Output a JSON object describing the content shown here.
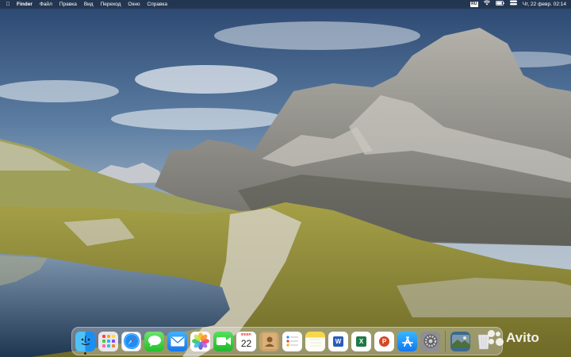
{
  "menubar": {
    "app_name": "Finder",
    "items": [
      "Файл",
      "Правка",
      "Вид",
      "Переход",
      "Окно",
      "Справка"
    ],
    "input_source": "RU",
    "clock": "Чт, 22 февр.  02:14",
    "icons": [
      "apple-logo",
      "wifi-icon",
      "battery-icon",
      "control-center-icon"
    ]
  },
  "dock": {
    "apps": [
      {
        "id": "finder",
        "icon": "finder-icon",
        "running": true
      },
      {
        "id": "launchpad",
        "icon": "launchpad-icon"
      },
      {
        "id": "safari",
        "icon": "safari-icon"
      },
      {
        "id": "messages",
        "icon": "messages-icon"
      },
      {
        "id": "mail",
        "icon": "mail-icon"
      },
      {
        "id": "photos",
        "icon": "photos-icon"
      },
      {
        "id": "facetime",
        "icon": "facetime-icon"
      },
      {
        "id": "calendar",
        "icon": "calendar-icon"
      },
      {
        "id": "contacts",
        "icon": "contacts-icon"
      },
      {
        "id": "reminders",
        "icon": "reminders-icon"
      },
      {
        "id": "notes",
        "icon": "notes-icon"
      },
      {
        "id": "word",
        "icon": "word-icon"
      },
      {
        "id": "excel",
        "icon": "excel-icon"
      },
      {
        "id": "powerpoint",
        "icon": "powerpoint-icon"
      },
      {
        "id": "appstore",
        "icon": "appstore-icon"
      },
      {
        "id": "settings",
        "icon": "settings-icon"
      }
    ],
    "calendar": {
      "month": "ФЕВР.",
      "day": "22"
    },
    "word_letter": "W",
    "excel_letter": "X",
    "ppt_letter": "P"
  },
  "watermark": {
    "text": "Avito"
  },
  "colors": {
    "menubar_bg": "#1e2837",
    "sky_top": "#2b4a70",
    "sky_bottom": "#b9c6d2",
    "grass": "#9c9a3a",
    "water": "#2a4560",
    "rock": "#8d8d8a"
  }
}
